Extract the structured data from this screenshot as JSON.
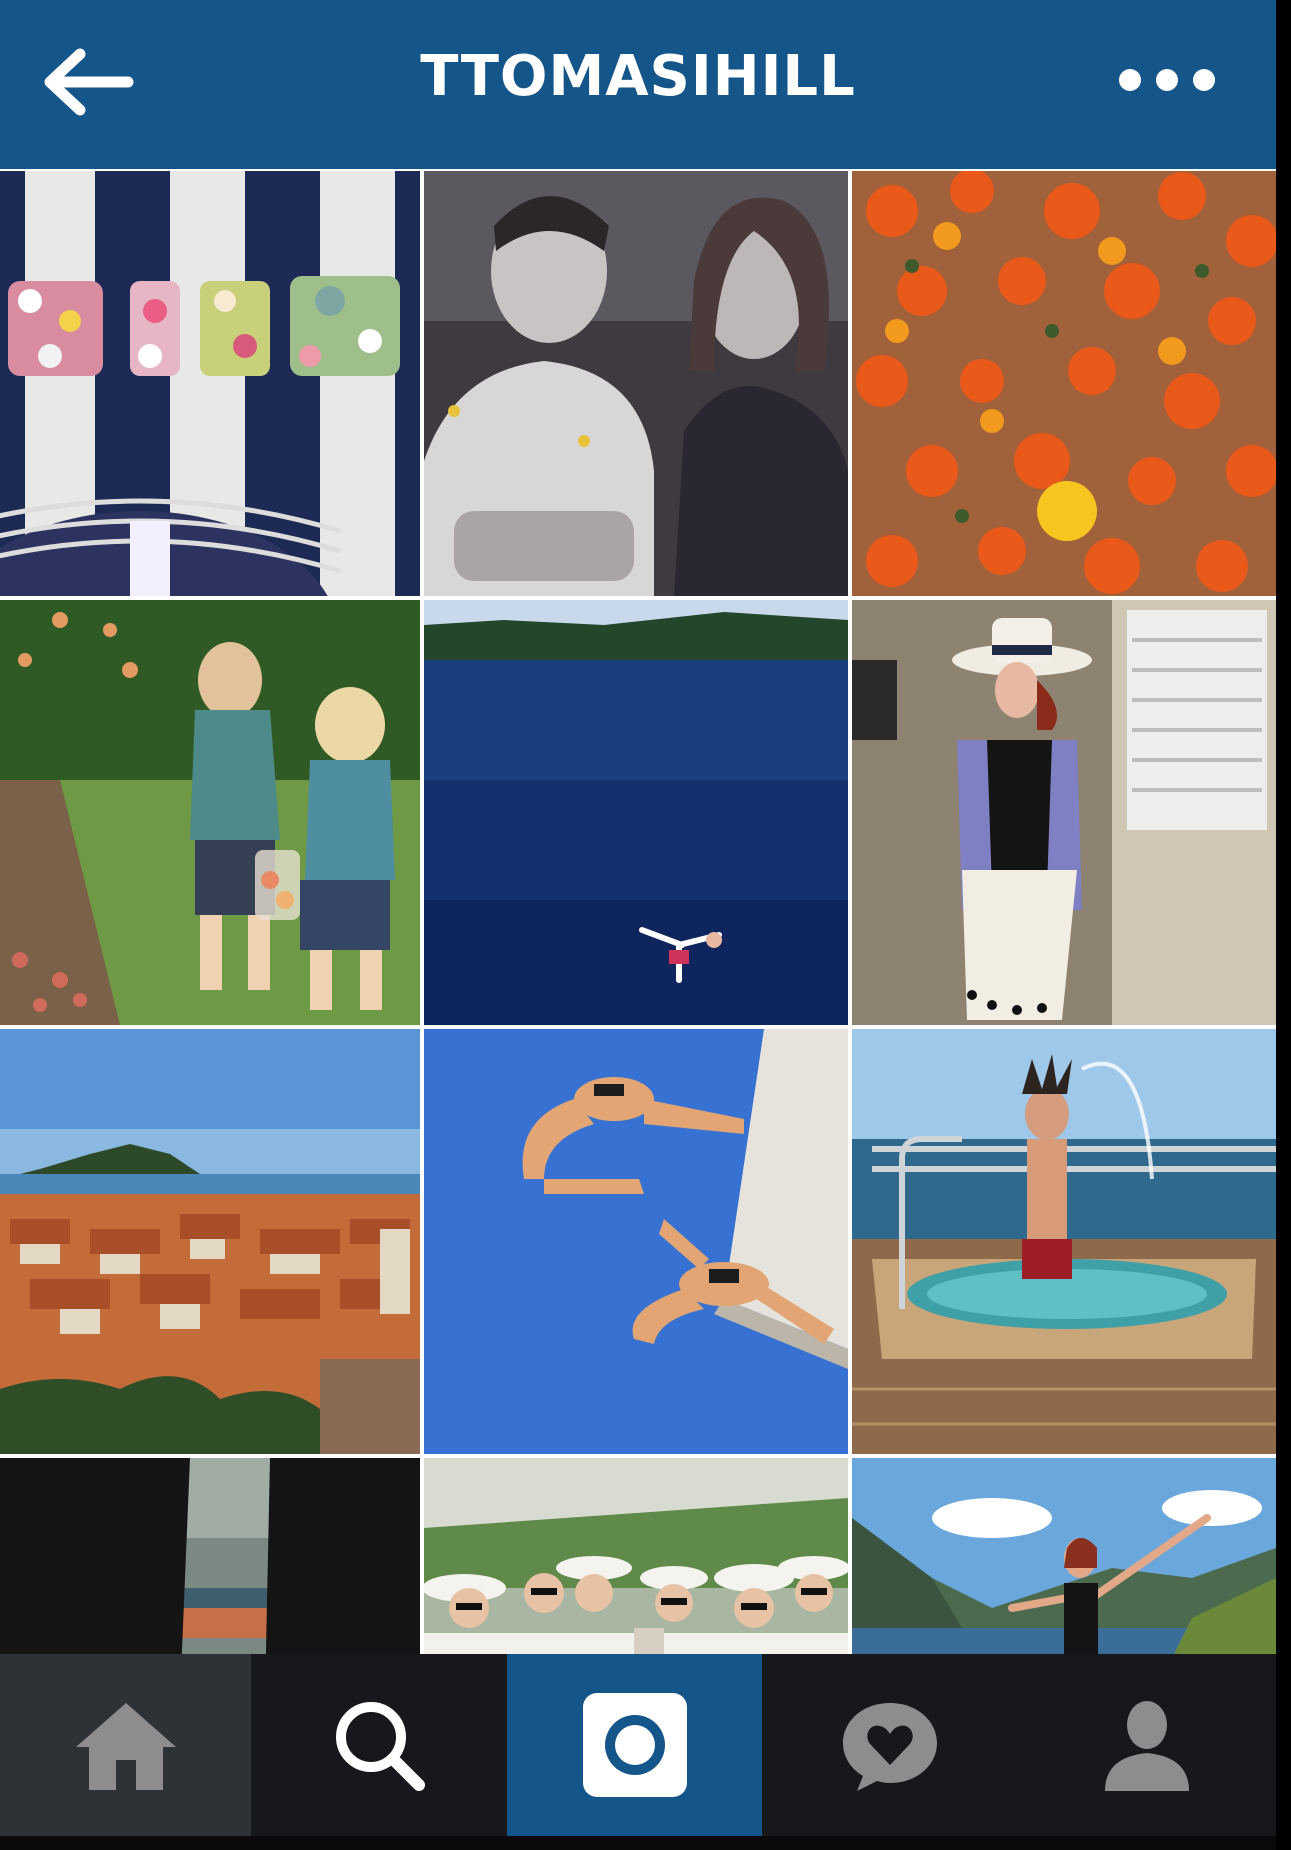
{
  "header": {
    "title": "TTOMASIHILL",
    "back_icon": "arrow-left-icon",
    "more_icon": "more-dots-icon",
    "background": "#14558a"
  },
  "grid": {
    "photos": [
      {
        "subject": "flower-letters-photo"
      },
      {
        "subject": "couple-photo"
      },
      {
        "subject": "orange-flowers-photo"
      },
      {
        "subject": "kids-peach-orchard-photo"
      },
      {
        "subject": "swimmer-sea-photo"
      },
      {
        "subject": "woman-hat-photo"
      },
      {
        "subject": "old-town-rooftops-photo"
      },
      {
        "subject": "jumping-people-photo"
      },
      {
        "subject": "hot-tub-yacht-photo"
      },
      {
        "subject": "rock-gap-view-photo"
      },
      {
        "subject": "group-hats-photo"
      },
      {
        "subject": "woman-bay-view-photo"
      }
    ]
  },
  "bottom_nav": {
    "items": [
      {
        "name": "home",
        "icon": "home-icon",
        "active": false
      },
      {
        "name": "search",
        "icon": "search-icon",
        "active": false
      },
      {
        "name": "camera",
        "icon": "camera-icon",
        "active": true
      },
      {
        "name": "activity",
        "icon": "heart-bubble-icon",
        "active": false
      },
      {
        "name": "profile",
        "icon": "person-icon",
        "active": false
      }
    ],
    "active_color": "#14558a"
  }
}
